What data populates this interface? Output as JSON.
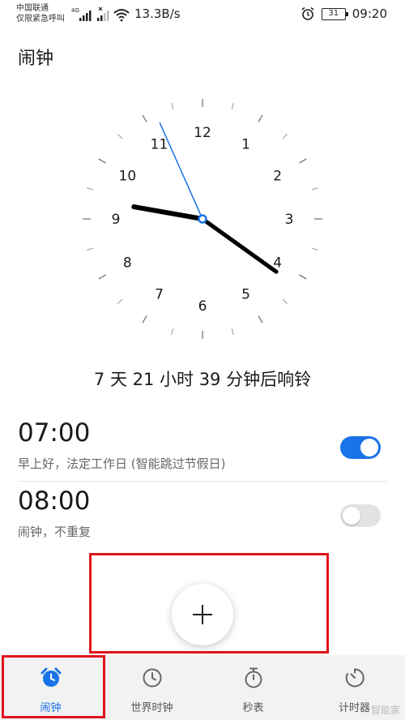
{
  "status_bar": {
    "carrier_line1": "中国联通",
    "carrier_line2": "仅限紧急呼叫",
    "net_type": "4G",
    "speed": "13.3B/s",
    "battery": "31",
    "time": "09:20"
  },
  "page": {
    "title": "闹钟"
  },
  "clock": {
    "numbers": [
      "12",
      "1",
      "2",
      "3",
      "4",
      "5",
      "6",
      "7",
      "8",
      "9",
      "10",
      "11"
    ],
    "hour": 9,
    "minute": 20,
    "second": 56,
    "hand_color": "#000000",
    "second_hand_color": "#1a73e8"
  },
  "countdown": "7 天 21 小时 39 分钟后响铃",
  "alarms": [
    {
      "time": "07:00",
      "label": "早上好，法定工作日 (智能跳过节假日)",
      "enabled": true
    },
    {
      "time": "08:00",
      "label": "闹钟，不重复",
      "enabled": false
    }
  ],
  "fab": {
    "icon": "plus-icon"
  },
  "tabs": [
    {
      "label": "闹钟",
      "icon": "alarm-clock-icon",
      "active": true
    },
    {
      "label": "世界时钟",
      "icon": "clock-icon",
      "active": false
    },
    {
      "label": "秒表",
      "icon": "stopwatch-icon",
      "active": false
    },
    {
      "label": "计时器",
      "icon": "timer-icon",
      "active": false
    }
  ],
  "colors": {
    "accent": "#1a73e8",
    "highlight": "#e0141c"
  },
  "watermark": "智能家"
}
